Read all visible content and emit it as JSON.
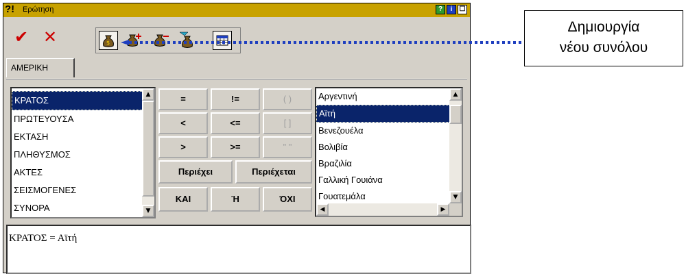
{
  "window": {
    "title_glyph": "?!",
    "title": "Ερώτηση",
    "help_btn": "?",
    "info_btn": "i",
    "max_btn": "☐"
  },
  "toolbar": {
    "ok_label": "✔",
    "cancel_label": "✕",
    "icons": [
      "moneybag-icon",
      "moneybag-plus-icon",
      "moneybag-minus-icon",
      "moneybag-filter-icon",
      "table-icon"
    ]
  },
  "tabs": [
    "ΑΜΕΡΙΚΗ"
  ],
  "fields": {
    "items": [
      "ΚΡΑΤΟΣ",
      "ΠΡΩΤΕΥΟΥΣΑ",
      "ΕΚΤΑΣΗ",
      "ΠΛΗΘΥΣΜΟΣ",
      "ΑΚΤΕΣ",
      "ΣΕΙΣΜΟΓΕΝΕΣ",
      "ΣΥΝΟΡΑ"
    ],
    "selected_index": 0
  },
  "operators": {
    "eq": "=",
    "neq": "!=",
    "paren": "( )",
    "lt": "<",
    "lte": "<=",
    "bracket": "[ ]",
    "gt": ">",
    "gte": ">=",
    "quotes": "\" \"",
    "contains": "Περιέχει",
    "contained": "Περιέχεται",
    "and": "ΚΑΙ",
    "or": "Ή",
    "not": "ΌΧΙ"
  },
  "values": {
    "items": [
      "Αργεντινή",
      "Αϊτή",
      "Βενεζουέλα",
      "Βολιβία",
      "Βραζιλία",
      "Γαλλική Γουιάνα",
      "Γουατεμάλα"
    ],
    "selected_index": 1
  },
  "query": {
    "text": "ΚΡΑΤΟΣ = Αϊτή"
  },
  "callout": {
    "line1": "Δημιουργία",
    "line2": "νέου συνόλου"
  },
  "colors": {
    "titlebar": "#c8a200",
    "selection": "#0a246a",
    "arrow": "#1f3fbf"
  }
}
